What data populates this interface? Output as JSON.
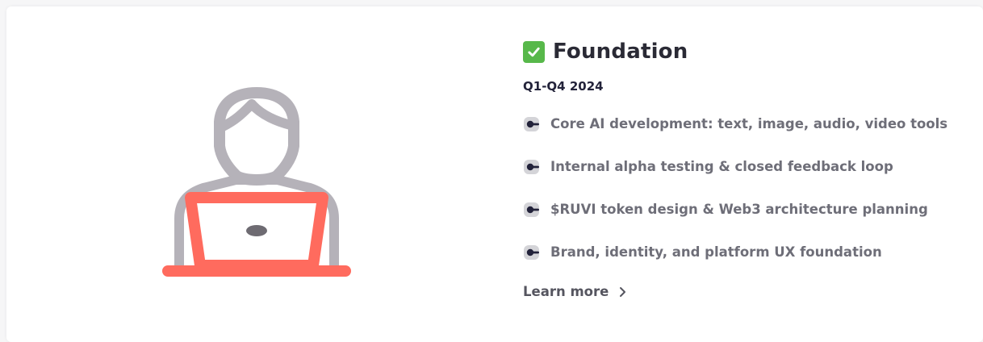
{
  "milestone": {
    "status_icon": "check-mark-icon",
    "title": "Foundation",
    "period": "Q1-Q4 2024",
    "items": [
      {
        "icon": "toggle-bullet-icon",
        "label": "Core AI development: text, image, audio, video tools"
      },
      {
        "icon": "toggle-bullet-icon",
        "label": "Internal alpha testing & closed feedback loop"
      },
      {
        "icon": "toggle-bullet-icon",
        "label": "$RUVI token design & Web3 architecture planning"
      },
      {
        "icon": "toggle-bullet-icon",
        "label": "Brand, identity, and platform UX foundation"
      }
    ],
    "cta": {
      "label": "Learn more",
      "icon": "chevron-right-icon"
    }
  },
  "illustration": {
    "icon": "person-at-laptop-icon"
  },
  "colors": {
    "check": "#57b84a",
    "laptop": "#ff6b5e",
    "person": "#b5b2b9",
    "bullet_bg": "#d4d4d8",
    "bullet_fg": "#22223a"
  }
}
